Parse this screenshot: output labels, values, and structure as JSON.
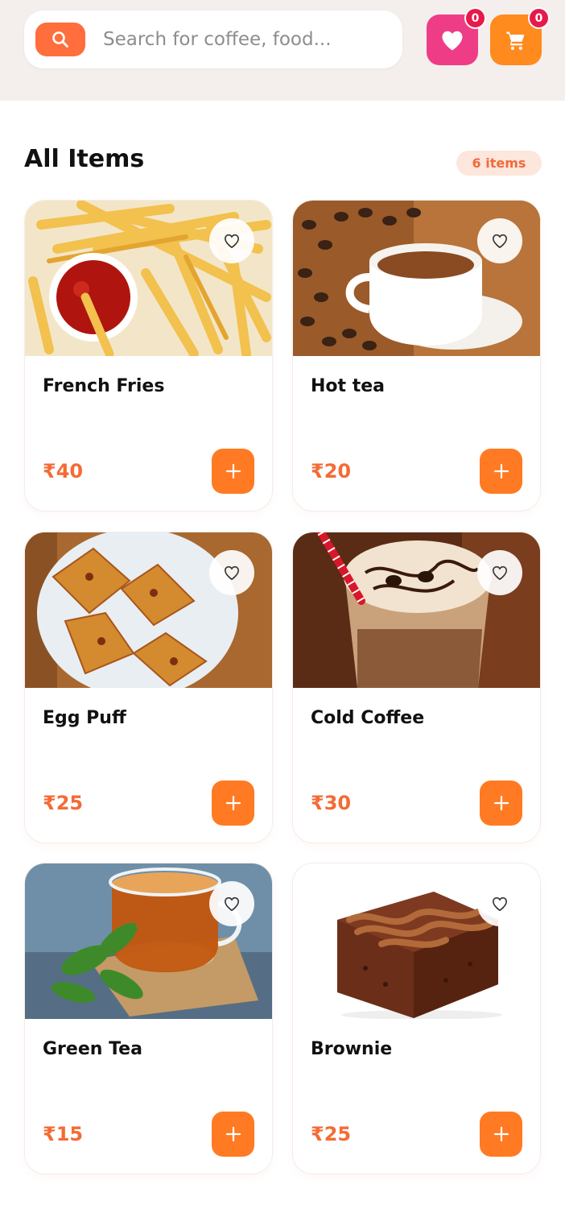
{
  "header": {
    "search": {
      "placeholder": "Search for coffee, food..."
    },
    "favorites_count": "0",
    "cart_count": "0"
  },
  "section": {
    "title": "All Items",
    "count_label": "6 items"
  },
  "items": [
    {
      "name": "French Fries",
      "price": "₹40"
    },
    {
      "name": "Hot tea",
      "price": "₹20"
    },
    {
      "name": "Egg Puff",
      "price": "₹25"
    },
    {
      "name": "Cold Coffee",
      "price": "₹30"
    },
    {
      "name": "Green Tea",
      "price": "₹15"
    },
    {
      "name": "Brownie",
      "price": "₹25"
    }
  ],
  "colors": {
    "accent": "#ff6e3c",
    "favorite": "#ee3d86",
    "cart": "#ff8a1e",
    "badge": "#e8194a",
    "price": "#f46b35"
  },
  "icons": {
    "search": "search-icon",
    "favorite": "heart-icon",
    "cart": "cart-icon",
    "add": "plus-icon"
  }
}
